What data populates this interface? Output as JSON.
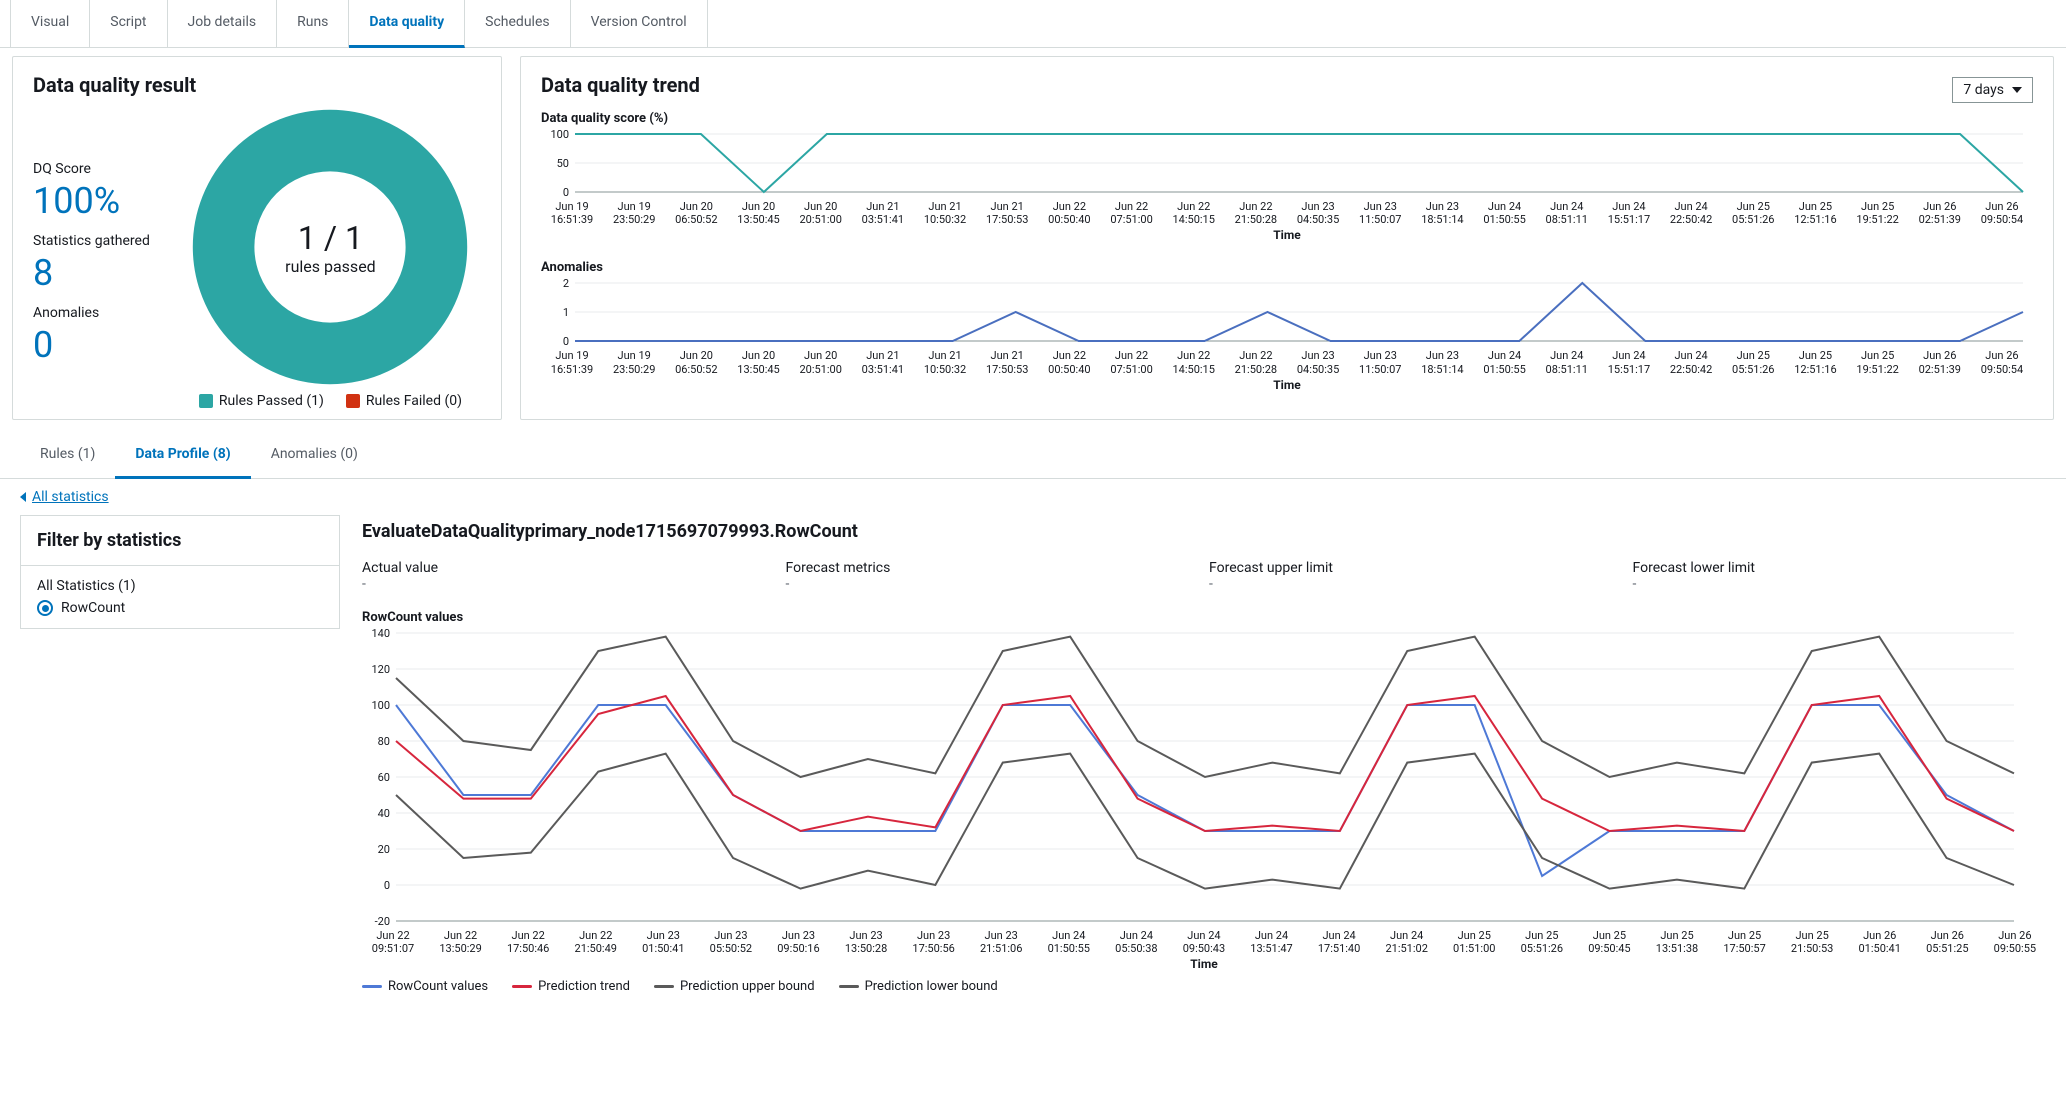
{
  "tabs": [
    "Visual",
    "Script",
    "Job details",
    "Runs",
    "Data quality",
    "Schedules",
    "Version Control"
  ],
  "active_tab": "Data quality",
  "dq_result": {
    "title": "Data quality result",
    "score_label": "DQ Score",
    "score_value": "100%",
    "stats_label": "Statistics gathered",
    "stats_value": "8",
    "anom_label": "Anomalies",
    "anom_value": "0",
    "center_big": "1 / 1",
    "center_small": "rules passed",
    "legend_passed": "Rules Passed (1)",
    "legend_failed": "Rules Failed (0)"
  },
  "trend": {
    "title": "Data quality trend",
    "range_selected": "7 days",
    "score_title": "Data quality score (%)",
    "anom_title": "Anomalies",
    "time_label": "Time",
    "x_ticks": [
      {
        "d": "Jun 19",
        "t": "16:51:39"
      },
      {
        "d": "Jun 19",
        "t": "23:50:29"
      },
      {
        "d": "Jun 20",
        "t": "06:50:52"
      },
      {
        "d": "Jun 20",
        "t": "13:50:45"
      },
      {
        "d": "Jun 20",
        "t": "20:51:00"
      },
      {
        "d": "Jun 21",
        "t": "03:51:41"
      },
      {
        "d": "Jun 21",
        "t": "10:50:32"
      },
      {
        "d": "Jun 21",
        "t": "17:50:53"
      },
      {
        "d": "Jun 22",
        "t": "00:50:40"
      },
      {
        "d": "Jun 22",
        "t": "07:51:00"
      },
      {
        "d": "Jun 22",
        "t": "14:50:15"
      },
      {
        "d": "Jun 22",
        "t": "21:50:28"
      },
      {
        "d": "Jun 23",
        "t": "04:50:35"
      },
      {
        "d": "Jun 23",
        "t": "11:50:07"
      },
      {
        "d": "Jun 23",
        "t": "18:51:14"
      },
      {
        "d": "Jun 24",
        "t": "01:50:55"
      },
      {
        "d": "Jun 24",
        "t": "08:51:11"
      },
      {
        "d": "Jun 24",
        "t": "15:51:17"
      },
      {
        "d": "Jun 24",
        "t": "22:50:42"
      },
      {
        "d": "Jun 25",
        "t": "05:51:26"
      },
      {
        "d": "Jun 25",
        "t": "12:51:16"
      },
      {
        "d": "Jun 25",
        "t": "19:51:22"
      },
      {
        "d": "Jun 26",
        "t": "02:51:39"
      },
      {
        "d": "Jun 26",
        "t": "09:50:54"
      }
    ]
  },
  "sec_tabs": [
    "Rules (1)",
    "Data Profile (8)",
    "Anomalies (0)"
  ],
  "sec_active": "Data Profile (8)",
  "back_link": "All statistics",
  "filter": {
    "title": "Filter by statistics",
    "all": "All Statistics (1)",
    "item": "RowCount"
  },
  "detail": {
    "title": "EvaluateDataQualityprimary_node1715697079993.RowCount",
    "labels": [
      "Actual value",
      "Forecast metrics",
      "Forecast upper limit",
      "Forecast lower limit"
    ],
    "vals": [
      "-",
      "-",
      "-",
      "-"
    ],
    "rc_title": "RowCount values",
    "time_label": "Time",
    "legend": [
      "RowCount values",
      "Prediction trend",
      "Prediction upper bound",
      "Prediction lower bound"
    ],
    "x_ticks": [
      {
        "d": "Jun 22",
        "t": "09:51:07"
      },
      {
        "d": "Jun 22",
        "t": "13:50:29"
      },
      {
        "d": "Jun 22",
        "t": "17:50:46"
      },
      {
        "d": "Jun 22",
        "t": "21:50:49"
      },
      {
        "d": "Jun 23",
        "t": "01:50:41"
      },
      {
        "d": "Jun 23",
        "t": "05:50:52"
      },
      {
        "d": "Jun 23",
        "t": "09:50:16"
      },
      {
        "d": "Jun 23",
        "t": "13:50:28"
      },
      {
        "d": "Jun 23",
        "t": "17:50:56"
      },
      {
        "d": "Jun 23",
        "t": "21:51:06"
      },
      {
        "d": "Jun 24",
        "t": "01:50:55"
      },
      {
        "d": "Jun 24",
        "t": "05:50:38"
      },
      {
        "d": "Jun 24",
        "t": "09:50:43"
      },
      {
        "d": "Jun 24",
        "t": "13:51:47"
      },
      {
        "d": "Jun 24",
        "t": "17:51:40"
      },
      {
        "d": "Jun 24",
        "t": "21:51:02"
      },
      {
        "d": "Jun 25",
        "t": "01:51:00"
      },
      {
        "d": "Jun 25",
        "t": "05:51:26"
      },
      {
        "d": "Jun 25",
        "t": "09:50:45"
      },
      {
        "d": "Jun 25",
        "t": "13:51:38"
      },
      {
        "d": "Jun 25",
        "t": "17:50:57"
      },
      {
        "d": "Jun 25",
        "t": "21:50:53"
      },
      {
        "d": "Jun 26",
        "t": "01:50:41"
      },
      {
        "d": "Jun 26",
        "t": "05:51:25"
      },
      {
        "d": "Jun 26",
        "t": "09:50:55"
      }
    ]
  },
  "chart_data": [
    {
      "type": "line",
      "name": "dq_score",
      "title": "Data quality score (%)",
      "xlabel": "Time",
      "ylabel": "",
      "ylim": [
        0,
        100
      ],
      "y_ticks": [
        0,
        50,
        100
      ],
      "x_index": [
        0,
        1,
        2,
        3,
        4,
        5,
        6,
        7,
        8,
        9,
        10,
        11,
        12,
        13,
        14,
        15,
        16,
        17,
        18,
        19,
        20,
        21,
        22,
        23
      ],
      "values": [
        100,
        100,
        100,
        0,
        100,
        100,
        100,
        100,
        100,
        100,
        100,
        100,
        100,
        100,
        100,
        100,
        100,
        100,
        100,
        100,
        100,
        100,
        100,
        0
      ]
    },
    {
      "type": "line",
      "name": "anomalies",
      "title": "Anomalies",
      "xlabel": "Time",
      "ylabel": "",
      "ylim": [
        0,
        2
      ],
      "y_ticks": [
        0,
        1,
        2
      ],
      "x_index": [
        0,
        1,
        2,
        3,
        4,
        5,
        6,
        7,
        8,
        9,
        10,
        11,
        12,
        13,
        14,
        15,
        16,
        17,
        18,
        19,
        20,
        21,
        22,
        23
      ],
      "values": [
        0,
        0,
        0,
        0,
        0,
        0,
        0,
        1,
        0,
        0,
        0,
        1,
        0,
        0,
        0,
        0,
        2,
        0,
        0,
        0,
        0,
        0,
        0,
        1
      ]
    },
    {
      "type": "line",
      "name": "rowcount",
      "title": "RowCount values",
      "xlabel": "Time",
      "ylabel": "",
      "ylim": [
        -20,
        140
      ],
      "y_ticks": [
        -20,
        0,
        20,
        40,
        60,
        80,
        100,
        120,
        140
      ],
      "x_index": [
        0,
        1,
        2,
        3,
        4,
        5,
        6,
        7,
        8,
        9,
        10,
        11,
        12,
        13,
        14,
        15,
        16,
        17,
        18,
        19,
        20,
        21,
        22,
        23,
        24
      ],
      "series": [
        {
          "name": "RowCount values",
          "color": "#4e79d6",
          "values": [
            100,
            50,
            50,
            100,
            100,
            50,
            30,
            30,
            30,
            100,
            100,
            50,
            30,
            30,
            30,
            100,
            100,
            5,
            30,
            30,
            30,
            100,
            100,
            50,
            30
          ]
        },
        {
          "name": "Prediction trend",
          "color": "#d7263d",
          "values": [
            80,
            48,
            48,
            95,
            105,
            50,
            30,
            38,
            32,
            100,
            105,
            48,
            30,
            33,
            30,
            100,
            105,
            48,
            30,
            33,
            30,
            100,
            105,
            48,
            30
          ]
        },
        {
          "name": "Prediction upper bound",
          "color": "#5a5a5a",
          "values": [
            115,
            80,
            75,
            130,
            138,
            80,
            60,
            70,
            62,
            130,
            138,
            80,
            60,
            68,
            62,
            130,
            138,
            80,
            60,
            68,
            62,
            130,
            138,
            80,
            62
          ]
        },
        {
          "name": "Prediction lower bound",
          "color": "#5a5a5a",
          "values": [
            50,
            15,
            18,
            63,
            73,
            15,
            -2,
            8,
            0,
            68,
            73,
            15,
            -2,
            3,
            -2,
            68,
            73,
            15,
            -2,
            3,
            -2,
            68,
            73,
            15,
            0
          ]
        }
      ]
    }
  ]
}
